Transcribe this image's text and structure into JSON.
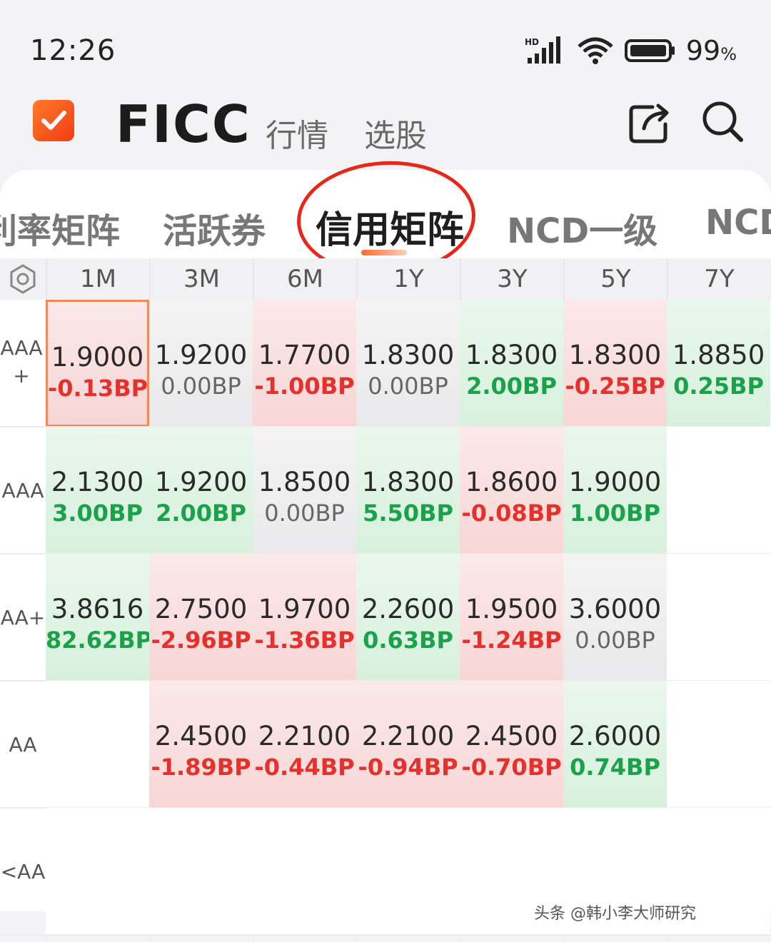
{
  "status_bar": {
    "time": "12:26",
    "network_badge": "HD",
    "battery_value": "99",
    "battery_unit": "%"
  },
  "header": {
    "title": "FICC",
    "tabs": [
      "行情",
      "选股"
    ]
  },
  "subtabs": {
    "items": [
      "利率矩阵",
      "活跃券",
      "信用矩阵",
      "NCD一级",
      "NCD"
    ],
    "active_index": 2
  },
  "matrix": {
    "columns": [
      "1M",
      "3M",
      "6M",
      "1Y",
      "3Y",
      "5Y",
      "7Y"
    ],
    "rows": [
      {
        "label": "AAA+",
        "cells": [
          {
            "value": "1.9000",
            "change": "-0.13BP",
            "tone": "red",
            "selected": true
          },
          {
            "value": "1.9200",
            "change": "0.00BP",
            "tone": "gray"
          },
          {
            "value": "1.7700",
            "change": "-1.00BP",
            "tone": "red"
          },
          {
            "value": "1.8300",
            "change": "0.00BP",
            "tone": "gray"
          },
          {
            "value": "1.8300",
            "change": "2.00BP",
            "tone": "green"
          },
          {
            "value": "1.8300",
            "change": "-0.25BP",
            "tone": "red"
          },
          {
            "value": "1.8850",
            "change": "0.25BP",
            "tone": "green"
          }
        ]
      },
      {
        "label": "AAA",
        "cells": [
          {
            "value": "2.1300",
            "change": "3.00BP",
            "tone": "green"
          },
          {
            "value": "1.9200",
            "change": "2.00BP",
            "tone": "green"
          },
          {
            "value": "1.8500",
            "change": "0.00BP",
            "tone": "gray"
          },
          {
            "value": "1.8300",
            "change": "5.50BP",
            "tone": "green"
          },
          {
            "value": "1.8600",
            "change": "-0.08BP",
            "tone": "red"
          },
          {
            "value": "1.9000",
            "change": "1.00BP",
            "tone": "green"
          },
          null
        ]
      },
      {
        "label": "AA+",
        "cells": [
          {
            "value": "3.8616",
            "change": "82.62BP",
            "tone": "green"
          },
          {
            "value": "2.7500",
            "change": "-2.96BP",
            "tone": "red"
          },
          {
            "value": "1.9700",
            "change": "-1.36BP",
            "tone": "red"
          },
          {
            "value": "2.2600",
            "change": "0.63BP",
            "tone": "green"
          },
          {
            "value": "1.9500",
            "change": "-1.24BP",
            "tone": "red"
          },
          {
            "value": "3.6000",
            "change": "0.00BP",
            "tone": "gray"
          },
          null
        ]
      },
      {
        "label": "AA",
        "cells": [
          null,
          {
            "value": "2.4500",
            "change": "-1.89BP",
            "tone": "red"
          },
          {
            "value": "2.2100",
            "change": "-0.44BP",
            "tone": "red"
          },
          {
            "value": "2.2100",
            "change": "-0.94BP",
            "tone": "red"
          },
          {
            "value": "2.4500",
            "change": "-0.70BP",
            "tone": "red"
          },
          {
            "value": "2.6000",
            "change": "0.74BP",
            "tone": "green"
          },
          null
        ]
      },
      {
        "label": "<AA",
        "cells": [
          null,
          null,
          null,
          null,
          null,
          null,
          null
        ]
      }
    ]
  },
  "colors": {
    "accent": "#ff6a2a",
    "up_red": "#e5302b",
    "down_green": "#1aa24a",
    "annotation": "#e8261a"
  },
  "icons": [
    "app-logo-check-icon",
    "signal-icon",
    "wifi-icon",
    "battery-icon",
    "share-icon",
    "search-icon",
    "settings-hexagon-icon"
  ],
  "watermark": "头条 @韩小李大师研究"
}
